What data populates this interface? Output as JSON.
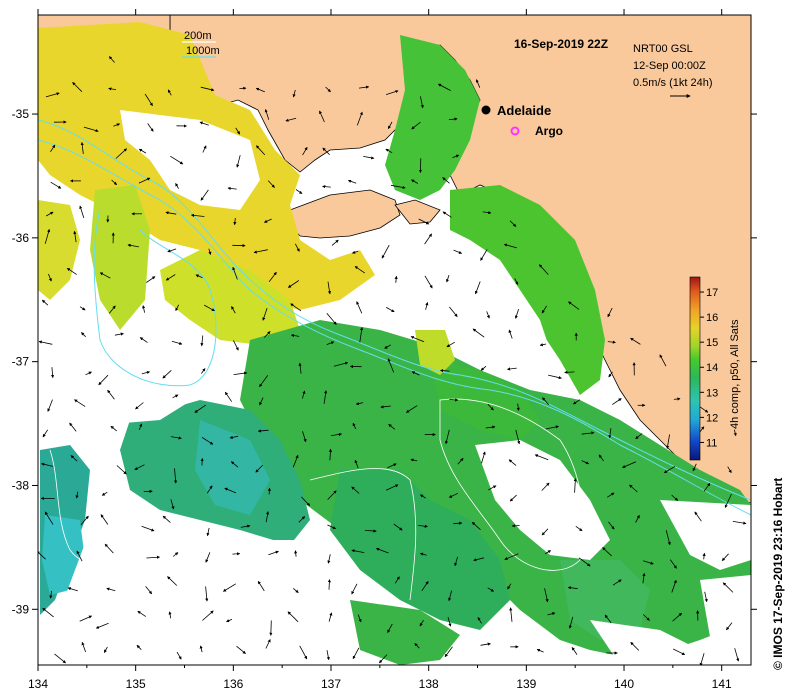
{
  "title": "16-Sep-2019 22Z",
  "product": {
    "line1": "NRT00 GSL",
    "line2": "12-Sep 00:00Z",
    "line3": "0.5m/s (1kt 24h)"
  },
  "legend": {
    "contour_200": "200m",
    "contour_1000": "1000m"
  },
  "places": {
    "city": "Adelaide",
    "float": "Argo"
  },
  "colorbar": {
    "title": "4h comp, p50, All Sats",
    "ticks": [
      "11",
      "12",
      "13",
      "14",
      "15",
      "16",
      "17"
    ],
    "range": [
      10.3,
      17.6
    ]
  },
  "credit": "© IMOS 17-Sep-2019 23:16 Hobart",
  "axes": {
    "x_ticks": [
      "134",
      "135",
      "136",
      "137",
      "138",
      "139",
      "140",
      "141"
    ],
    "y_ticks": [
      "-35",
      "-36",
      "-37",
      "-38",
      "-39"
    ],
    "x_range": [
      134,
      141.3
    ],
    "y_range": [
      -39.45,
      -34.2
    ]
  },
  "colors": {
    "land": "#f9c99b",
    "cloud": "#ffffff",
    "contour": "#66ddee",
    "arrow": "#000000",
    "argo": "#ff33ff"
  }
}
